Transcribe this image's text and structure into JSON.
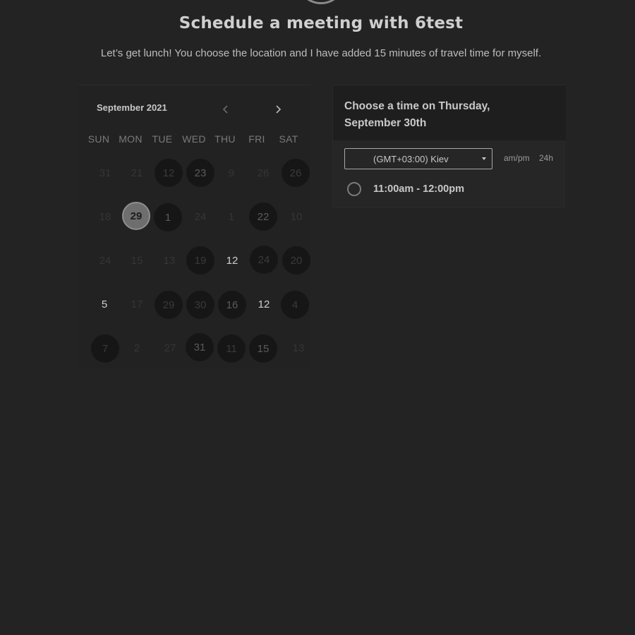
{
  "header": {
    "title": "Schedule a meeting with 6test",
    "subtitle": "Let’s get lunch! You choose the location and I have added 15 minutes of travel time for myself."
  },
  "calendar": {
    "month_label": "September 2021",
    "prev_icon": "chevron-left-icon",
    "next_icon": "chevron-right-icon",
    "weekdays": [
      "SUN",
      "MON",
      "TUE",
      "WED",
      "THU",
      "FRI",
      "SAT"
    ],
    "weeks": [
      [
        "31",
        "21",
        "12",
        "23",
        "9",
        "26",
        "26"
      ],
      [
        "18",
        "29",
        "1",
        "24",
        "1",
        "22",
        "10"
      ],
      [
        "24",
        "15",
        "13",
        "19",
        "12",
        "24",
        "20"
      ],
      [
        "5",
        "17",
        "29",
        "30",
        "16",
        "12",
        "4"
      ],
      [
        "7",
        "2",
        "27",
        "31",
        "11",
        "15",
        "13"
      ]
    ],
    "selected_day": "29"
  },
  "time_panel": {
    "heading_line1": "Choose a time on Thursday,",
    "heading_line2": "September 30th",
    "timezone": "(GMT+03:00) Kiev",
    "format_ampm": "am/pm",
    "format_24h": "24h",
    "slots": [
      "11:00am - 12:00pm"
    ]
  },
  "colors": {
    "background": "#232323",
    "selected_day": "#6e6e6e"
  }
}
